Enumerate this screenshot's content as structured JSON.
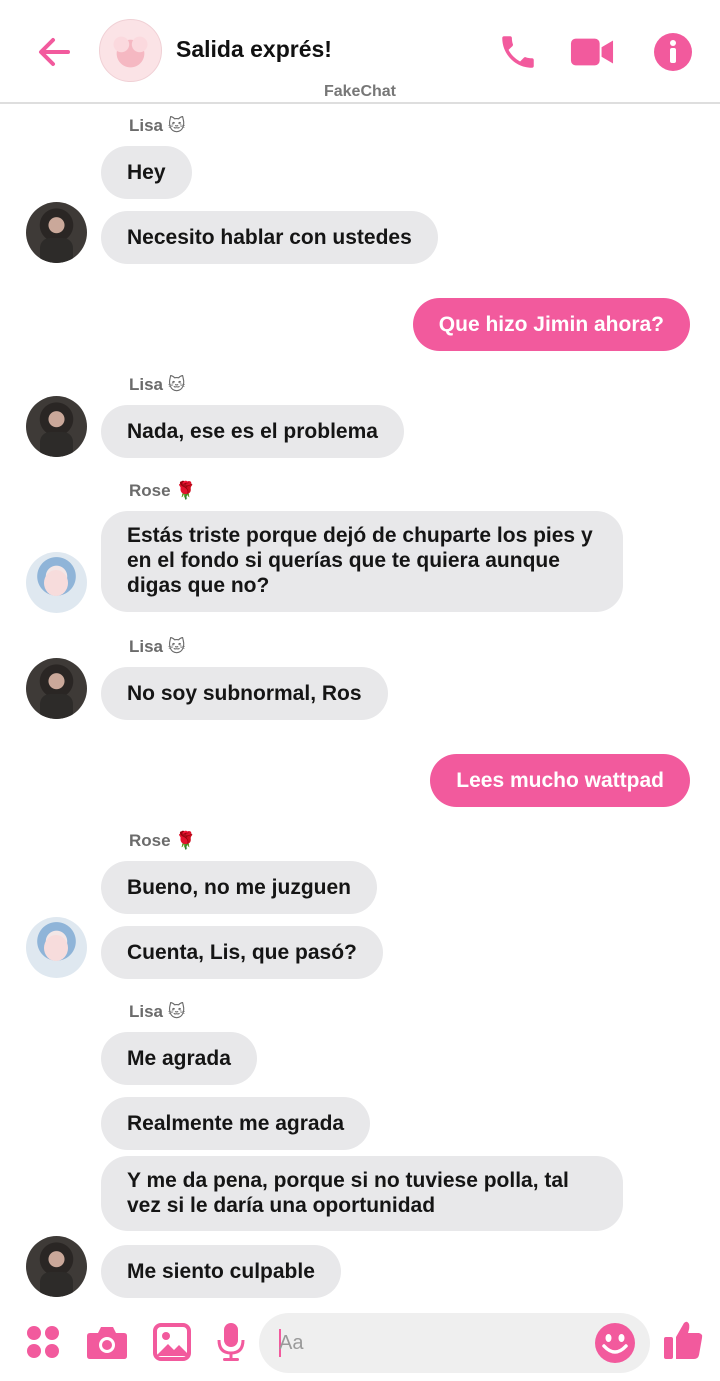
{
  "header": {
    "title": "Salida exprés!",
    "watermark": "FakeChat"
  },
  "colors": {
    "accent": "#f25a9d",
    "incoming_bubble": "#e8e8ea"
  },
  "icons": [
    "back-arrow-icon",
    "phone-icon",
    "video-camera-icon",
    "info-icon",
    "apps-grid-icon",
    "camera-icon",
    "image-icon",
    "microphone-icon",
    "emoji-icon",
    "thumbs-up-icon"
  ],
  "messages": [
    {
      "sender": "Lisa 🐱",
      "text": "Hey",
      "dir": "in"
    },
    {
      "text": "Necesito hablar con ustedes",
      "dir": "in"
    },
    {
      "text": "Que hizo Jimin ahora?",
      "dir": "out"
    },
    {
      "sender": "Lisa 🐱",
      "text": "Nada, ese es el problema",
      "dir": "in"
    },
    {
      "sender": "Rose 🌹",
      "text": "Estás triste porque dejó de chuparte los pies y en el fondo si querías que te quiera aunque digas que no?",
      "dir": "in"
    },
    {
      "sender": "Lisa 🐱",
      "text": "No soy subnormal, Ros",
      "dir": "in"
    },
    {
      "text": "Lees mucho wattpad",
      "dir": "out"
    },
    {
      "sender": "Rose 🌹",
      "text": "Bueno, no me juzguen",
      "dir": "in"
    },
    {
      "text": "Cuenta, Lis, que pasó?",
      "dir": "in"
    },
    {
      "sender": "Lisa 🐱",
      "text": "Me agrada",
      "dir": "in"
    },
    {
      "text": "Realmente me agrada",
      "dir": "in"
    },
    {
      "text": "Y me da pena, porque si no tuviese polla, tal vez si le daría una oportunidad",
      "dir": "in"
    },
    {
      "text": "Me siento culpable",
      "dir": "in"
    }
  ],
  "composer": {
    "placeholder": "Aa"
  }
}
